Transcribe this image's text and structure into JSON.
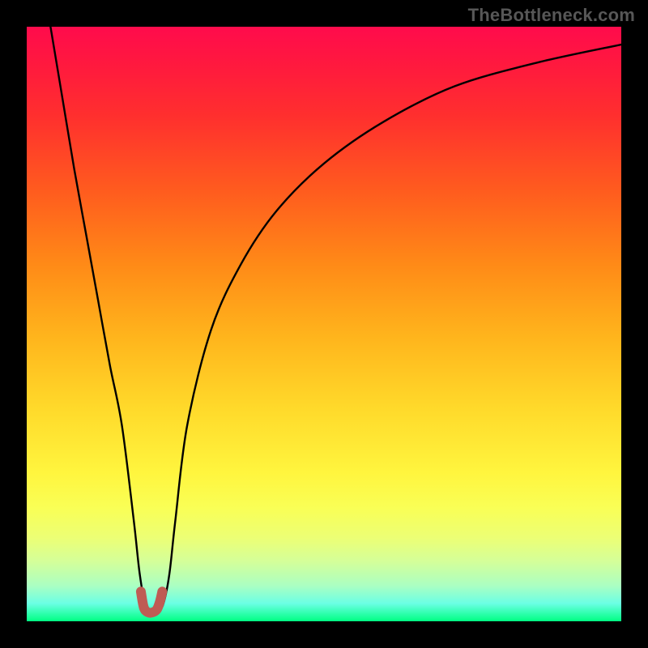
{
  "watermark": "TheBottleneck.com",
  "chart_data": {
    "type": "line",
    "title": "",
    "xlabel": "",
    "ylabel": "",
    "xlim": [
      0,
      100
    ],
    "ylim": [
      0,
      100
    ],
    "grid": false,
    "legend": false,
    "series": [
      {
        "name": "bottleneck-curve",
        "color": "#000000",
        "x": [
          4,
          6,
          8,
          10,
          12,
          14,
          16,
          18,
          19,
          20,
          21,
          22,
          23,
          24,
          25,
          27,
          31,
          36,
          42,
          50,
          60,
          72,
          86,
          100
        ],
        "y": [
          100,
          88,
          76,
          65,
          54,
          43,
          33,
          17,
          8,
          2.5,
          1.5,
          1.5,
          3,
          8,
          17,
          33,
          49,
          60,
          69,
          77,
          84,
          90,
          94,
          97
        ]
      },
      {
        "name": "highlight-min",
        "color": "#bf5b54",
        "x": [
          19.2,
          19.7,
          20.4,
          21.2,
          21.9,
          22.4,
          22.8
        ],
        "y": [
          5.0,
          2.3,
          1.5,
          1.5,
          2.0,
          3.3,
          5.0
        ]
      }
    ],
    "annotations": []
  }
}
